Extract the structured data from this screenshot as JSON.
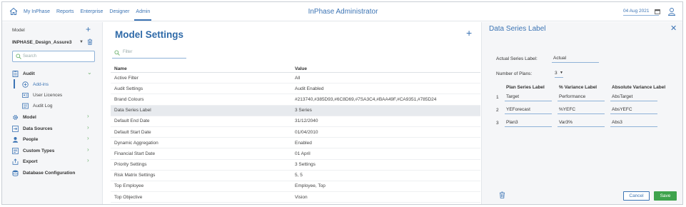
{
  "nav": {
    "items": [
      "My InPhase",
      "Reports",
      "Enterprise",
      "Designer",
      "Admin"
    ],
    "active": "Admin",
    "app_title": "InPhase Administrator",
    "date": "04 Aug 2021"
  },
  "sidebar": {
    "model_label": "Model",
    "model_name": "INPHASE_Design_Assure3",
    "search_placeholder": "Search",
    "audit": {
      "label": "Audit",
      "subitems": [
        "Add-ins",
        "User Licences",
        "Audit Log"
      ]
    },
    "items": [
      "Model",
      "Data Sources",
      "People",
      "Custom Types",
      "Export",
      "Database Configuration"
    ]
  },
  "main": {
    "title": "Model Settings",
    "filter_placeholder": "Filter",
    "columns": [
      "Name",
      "Value"
    ],
    "rows": [
      [
        "Active Filter",
        "All"
      ],
      [
        "Audit Settings",
        "Audit Enabled"
      ],
      [
        "Brand Colours",
        "#213740,#385D93,#6C8D69,#7SA3C4,#BAA49F,#CA9351,#785D24"
      ],
      [
        "Data Series Label",
        "3 Series"
      ],
      [
        "Default End Date",
        "31/12/2040"
      ],
      [
        "Default Start Date",
        "01/04/2010"
      ],
      [
        "Dynamic Aggregation",
        "Enabled"
      ],
      [
        "Financial Start Date",
        "01 April"
      ],
      [
        "Priority Settings",
        "3 Settings"
      ],
      [
        "Risk Matrix Settings",
        "5, 5"
      ],
      [
        "Top Employee",
        "Employee, Top"
      ],
      [
        "Top Objective",
        "Vision"
      ]
    ],
    "selected_row": 3
  },
  "panel": {
    "title": "Data Series Label",
    "actual_label": "Actual Series Label:",
    "actual_value": "Actual",
    "plans_label": "Number of Plans:",
    "plans_value": "3",
    "col_headers": [
      "Plan Series Label",
      "% Variance Label",
      "Absolute Variance Label"
    ],
    "rows": [
      {
        "num": "1",
        "plan": "Target",
        "pct": "Performance",
        "abs": "AbsTarget"
      },
      {
        "num": "2",
        "plan": "YEForecast",
        "pct": "%YEFC",
        "abs": "AbsYEFC"
      },
      {
        "num": "3",
        "plan": "Plan3",
        "pct": "Var3%",
        "abs": "Abs3"
      }
    ],
    "cancel": "Cancel",
    "save": "Save"
  },
  "colors": {
    "accent": "#3c74b4",
    "save": "#3fa34d",
    "chevron": "#6fb36f"
  }
}
